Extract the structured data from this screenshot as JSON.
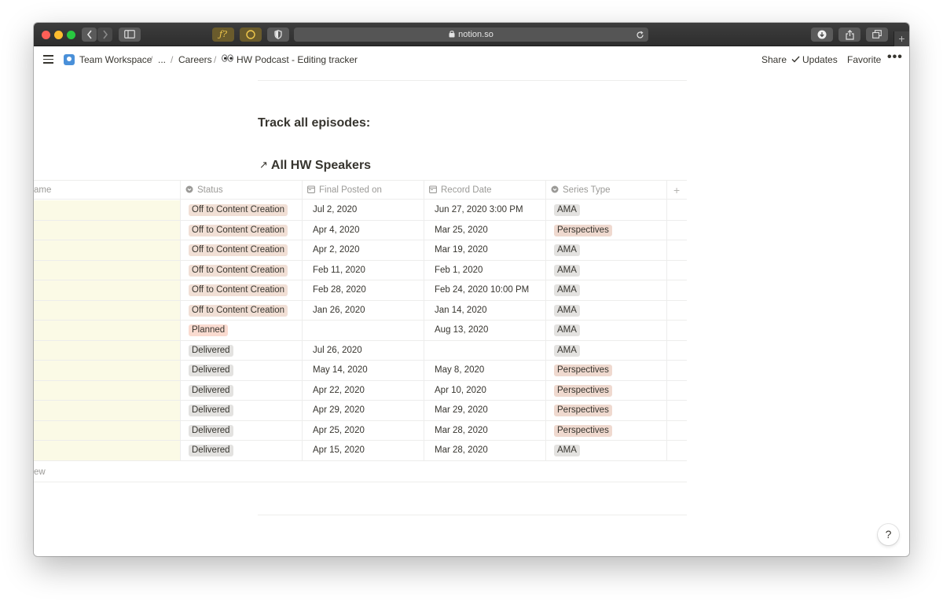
{
  "browser": {
    "url": "notion.so",
    "ext1_label": "ƒ?"
  },
  "topbar": {
    "breadcrumbs": [
      "Team Workspace",
      "...",
      "Careers",
      "HW Podcast - Editing tracker"
    ],
    "separator": "/",
    "share": "Share",
    "updates": "Updates",
    "favorite": "Favorite",
    "more": "•••"
  },
  "page": {
    "heading_track": "Track all episodes:",
    "heading_speakers": "All HW Speakers",
    "link_arrow": "↗"
  },
  "table": {
    "columns": [
      "ame",
      "Status",
      "Final Posted on",
      "Record Date",
      "Series Type"
    ],
    "add_column": "+",
    "rows": [
      {
        "status": "Off to Content Creation",
        "final_posted": "Jul 2, 2020",
        "record_date": "Jun 27, 2020 3:00 PM",
        "series": "AMA"
      },
      {
        "status": "Off to Content Creation",
        "final_posted": "Apr 4, 2020",
        "record_date": "Mar 25, 2020",
        "series": "Perspectives"
      },
      {
        "status": "Off to Content Creation",
        "final_posted": "Apr 2, 2020",
        "record_date": "Mar 19, 2020",
        "series": "AMA"
      },
      {
        "status": "Off to Content Creation",
        "final_posted": "Feb 11, 2020",
        "record_date": "Feb 1, 2020",
        "series": "AMA"
      },
      {
        "status": "Off to Content Creation",
        "final_posted": "Feb 28, 2020",
        "record_date": "Feb 24, 2020 10:00 PM",
        "series": "AMA"
      },
      {
        "status": "Off to Content Creation",
        "final_posted": "Jan 26, 2020",
        "record_date": "Jan 14, 2020",
        "series": "AMA"
      },
      {
        "status": "Planned",
        "final_posted": "",
        "record_date": "Aug 13, 2020",
        "series": "AMA"
      },
      {
        "status": "Delivered",
        "final_posted": "Jul 26, 2020",
        "record_date": "",
        "series": "AMA"
      },
      {
        "status": "Delivered",
        "final_posted": "May 14, 2020",
        "record_date": "May 8, 2020",
        "series": "Perspectives"
      },
      {
        "status": "Delivered",
        "final_posted": "Apr 22, 2020",
        "record_date": "Apr 10, 2020",
        "series": "Perspectives"
      },
      {
        "status": "Delivered",
        "final_posted": "Apr 29, 2020",
        "record_date": "Mar 29, 2020",
        "series": "Perspectives"
      },
      {
        "status": "Delivered",
        "final_posted": "Apr 25, 2020",
        "record_date": "Mar 28, 2020",
        "series": "Perspectives"
      },
      {
        "status": "Delivered",
        "final_posted": "Apr 15, 2020",
        "record_date": "Mar 28, 2020",
        "series": "AMA"
      }
    ],
    "new_row": "ew"
  },
  "help": "?",
  "colors": {
    "tag_off_to_content": "#f1dfd5",
    "tag_planned": "#fadbd0",
    "tag_delivered": "#e3e2e0",
    "tag_ama": "#e3e2e0",
    "tag_perspectives": "#efd9cf",
    "name_highlight": "#fbfae6"
  }
}
